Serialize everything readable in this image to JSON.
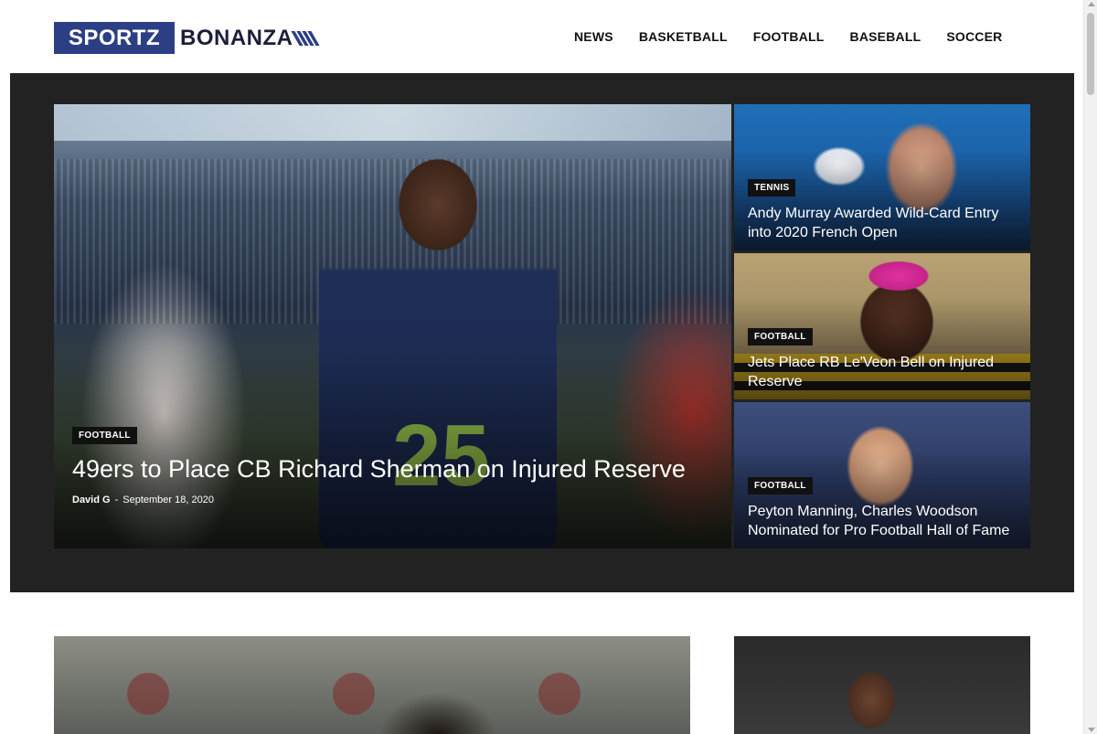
{
  "logo": {
    "box_text": "SPORTZ",
    "text": "BONANZA",
    "brand_color": "#2c3e84"
  },
  "nav": {
    "items": [
      {
        "label": "NEWS"
      },
      {
        "label": "BASKETBALL"
      },
      {
        "label": "FOOTBALL"
      },
      {
        "label": "BASEBALL"
      },
      {
        "label": "SOCCER"
      }
    ]
  },
  "hero": {
    "main": {
      "category": "FOOTBALL",
      "title": "49ers to Place CB Richard Sherman on Injured Reserve",
      "author": "David G",
      "separator": "-",
      "date": "September 18, 2020"
    },
    "side": [
      {
        "category": "TENNIS",
        "title": "Andy Murray Awarded Wild-Card Entry into 2020 French Open"
      },
      {
        "category": "FOOTBALL",
        "title": "Jets Place RB Le'Veon Bell on Injured Reserve"
      },
      {
        "category": "FOOTBALL",
        "title": "Peyton Manning, Charles Woodson Nominated for Pro Football Hall of Fame"
      }
    ]
  },
  "colors": {
    "hero_background": "#222222",
    "tag_background": "#111111"
  }
}
